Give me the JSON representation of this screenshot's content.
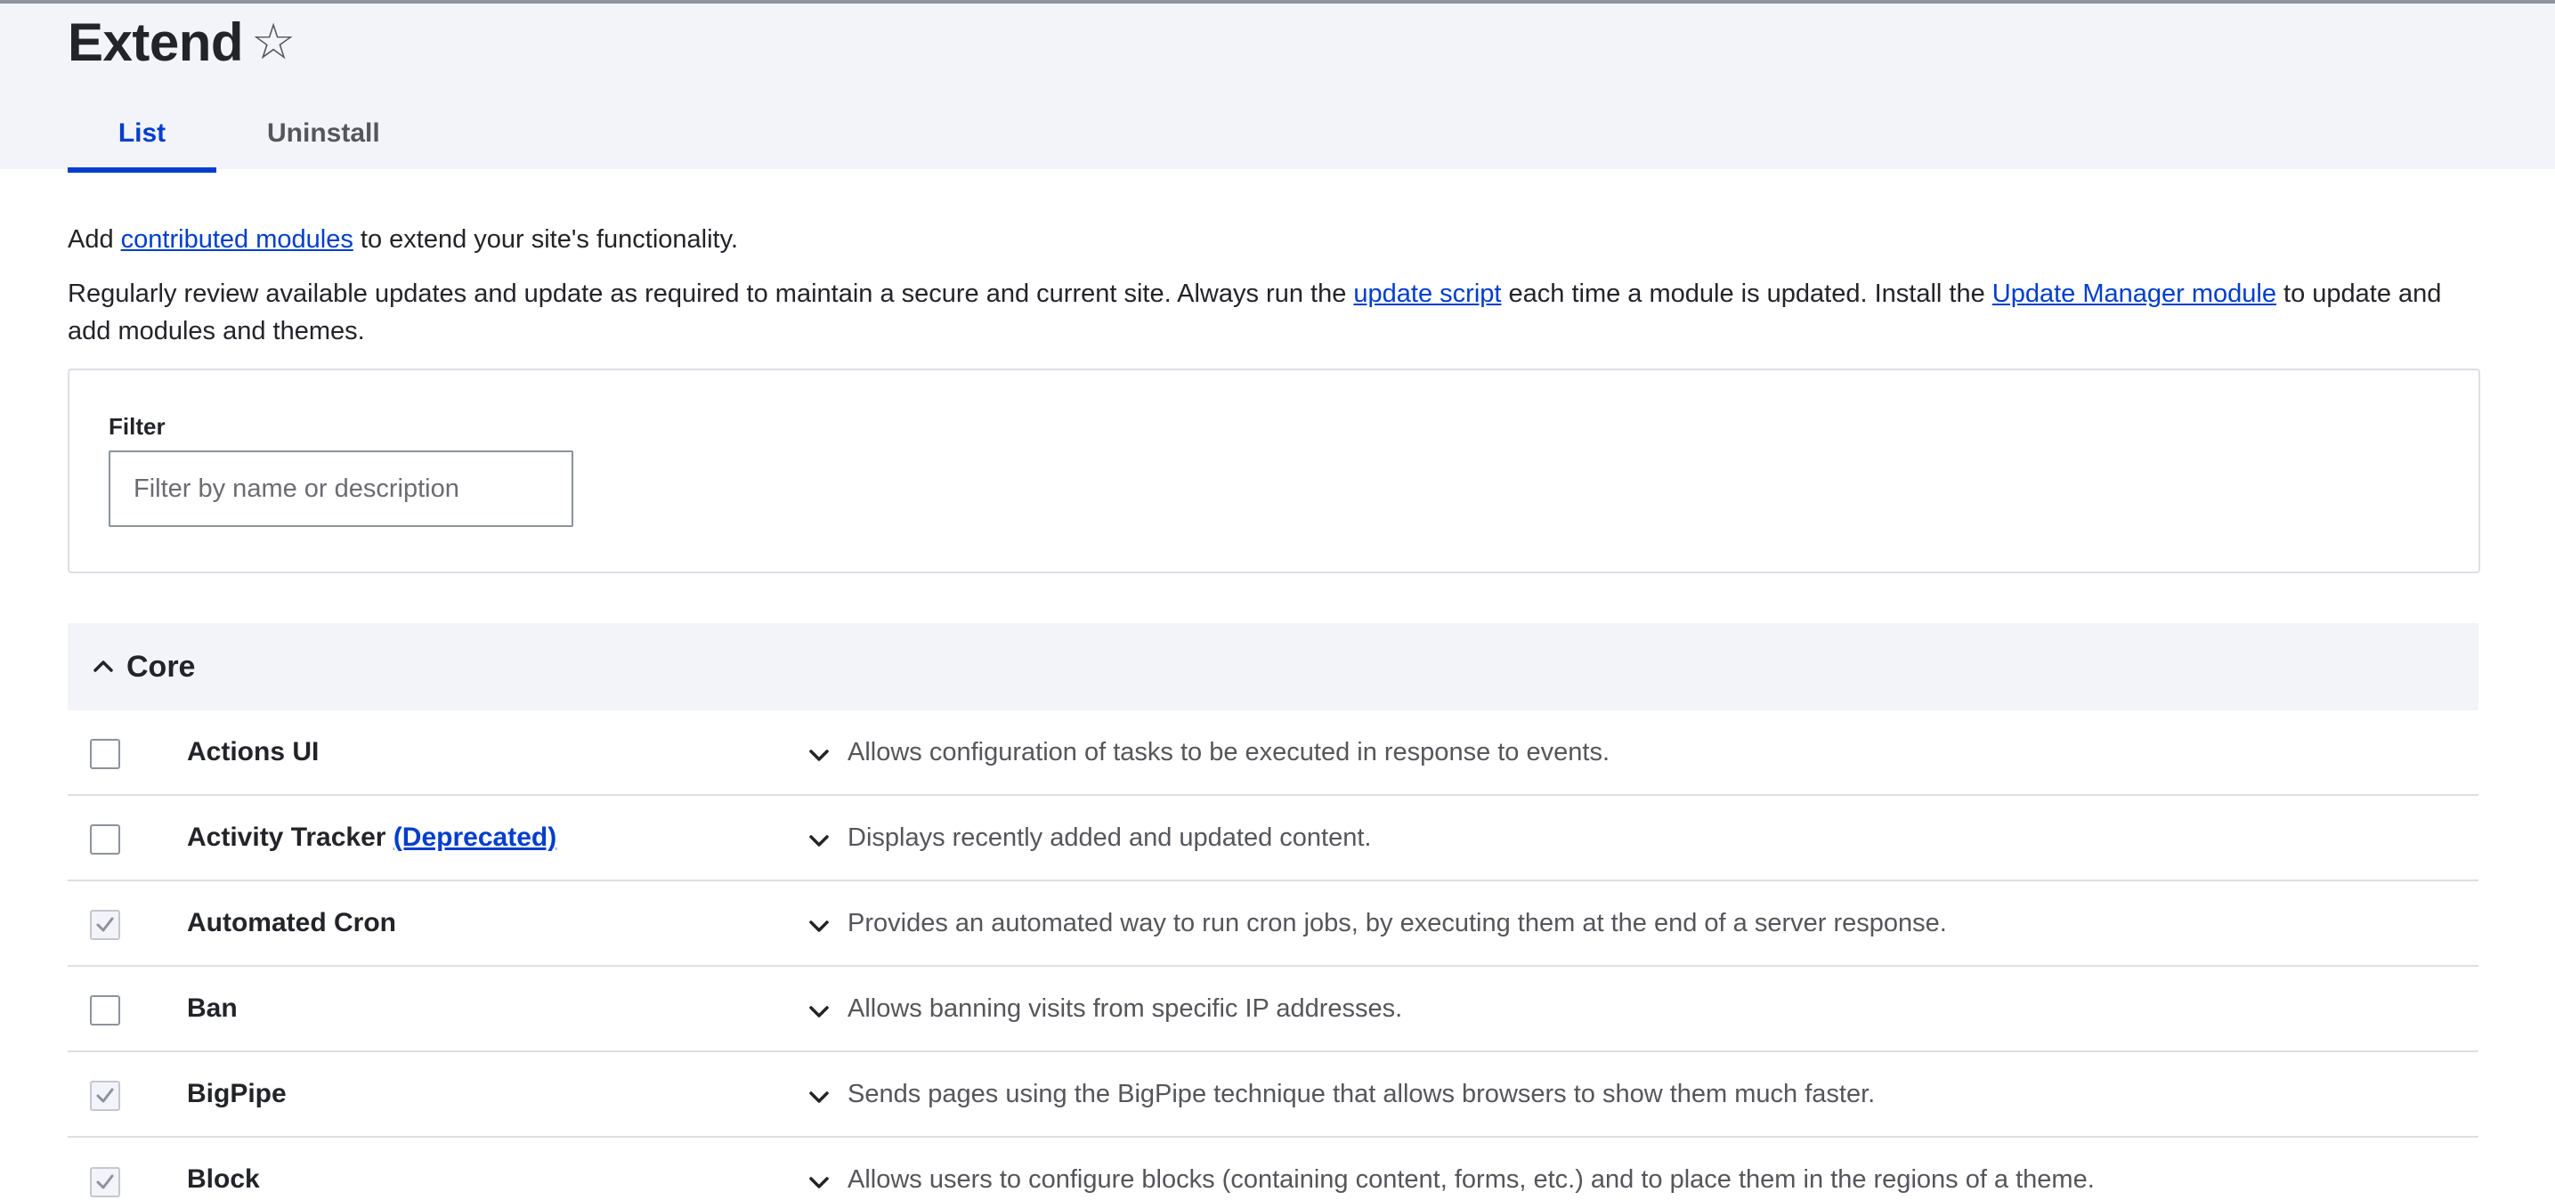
{
  "header": {
    "title": "Extend",
    "favorite_icon": "star-outline-icon",
    "tabs": [
      {
        "label": "List",
        "active": true
      },
      {
        "label": "Uninstall",
        "active": false
      }
    ]
  },
  "intro": {
    "p1_before": "Add ",
    "p1_link": "contributed modules",
    "p1_after": " to extend your site's functionality.",
    "p2_part1": "Regularly review available updates and update as required to maintain a secure and current site. Always run the ",
    "p2_link1": "update script",
    "p2_part2": " each time a module is updated. Install the ",
    "p2_link2": "Update Manager module",
    "p2_part3": " to update and add modules and themes."
  },
  "filter": {
    "label": "Filter",
    "placeholder": "Filter by name or description",
    "value": ""
  },
  "group": {
    "title": "Core",
    "expanded": true
  },
  "modules": [
    {
      "name": "Actions UI",
      "deprecated_label": "",
      "checked": false,
      "description": "Allows configuration of tasks to be executed in response to events."
    },
    {
      "name": "Activity Tracker",
      "deprecated_label": "(Deprecated)",
      "checked": false,
      "description": "Displays recently added and updated content."
    },
    {
      "name": "Automated Cron",
      "deprecated_label": "",
      "checked": true,
      "description": "Provides an automated way to run cron jobs, by executing them at the end of a server response."
    },
    {
      "name": "Ban",
      "deprecated_label": "",
      "checked": false,
      "description": "Allows banning visits from specific IP addresses."
    },
    {
      "name": "BigPipe",
      "deprecated_label": "",
      "checked": true,
      "description": "Sends pages using the BigPipe technique that allows browsers to show them much faster."
    },
    {
      "name": "Block",
      "deprecated_label": "",
      "checked": true,
      "description": "Allows users to configure blocks (containing content, forms, etc.) and to place them in the regions of a theme."
    }
  ],
  "colors": {
    "accent": "#003ecc",
    "header_bg": "#f3f4f9",
    "text": "#232429",
    "muted_text": "#55565b",
    "border": "#dedfe4"
  }
}
